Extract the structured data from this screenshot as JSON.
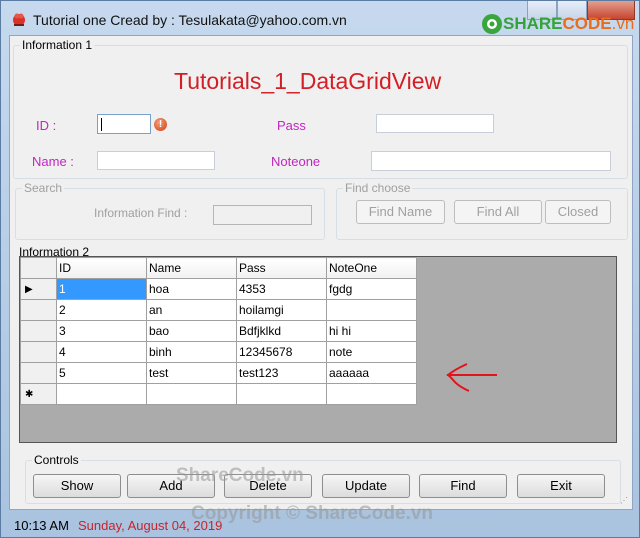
{
  "window": {
    "title": "Tutorial one Cread by : Tesulakata@yahoo.com.vn",
    "watermark_logo": {
      "part1": "SHARE",
      "part2": "CODE",
      "part3": ".vn"
    }
  },
  "info1": {
    "group_label": "Information 1",
    "heading": "Tutorials_1_DataGridView",
    "id_label": "ID :",
    "id_value": "",
    "pass_label": "Pass",
    "pass_value": "",
    "name_label": "Name :",
    "name_value": "",
    "noteone_label": "Noteone",
    "noteone_value": "",
    "error_icon": "!"
  },
  "search": {
    "group_label": "Search",
    "find_label": "Information Find :",
    "find_value": ""
  },
  "find_choose": {
    "group_label": "Find choose",
    "buttons": [
      "Find Name",
      "Find All",
      "Closed"
    ]
  },
  "info2": {
    "group_label": "Information 2",
    "columns": [
      "ID",
      "Name",
      "Pass",
      "NoteOne"
    ],
    "rows": [
      [
        "1",
        "hoa",
        "4353",
        "fgdg"
      ],
      [
        "2",
        "an",
        "hoilamgi",
        ""
      ],
      [
        "3",
        "bao",
        "Bdfjklkd",
        "hi hi"
      ],
      [
        "4",
        "binh",
        "12345678",
        "note"
      ],
      [
        "5",
        "test",
        "test123",
        "aaaaaa"
      ]
    ],
    "current_row_marker": "▶",
    "new_row_marker": "✱"
  },
  "controls": {
    "group_label": "Controls",
    "buttons": [
      "Show",
      "Add",
      "Delete",
      "Update",
      "Find",
      "Exit"
    ]
  },
  "status": {
    "time": "10:13 AM",
    "date": "Sunday, August 04, 2019"
  },
  "watermarks": {
    "mid": "ShareCode.vn",
    "bottom": "Copyright © ShareCode.vn"
  },
  "colors": {
    "heading": "#d21f26",
    "label_purple": "#c026c0",
    "selection": "#3399ff",
    "date": "#c8232b"
  }
}
